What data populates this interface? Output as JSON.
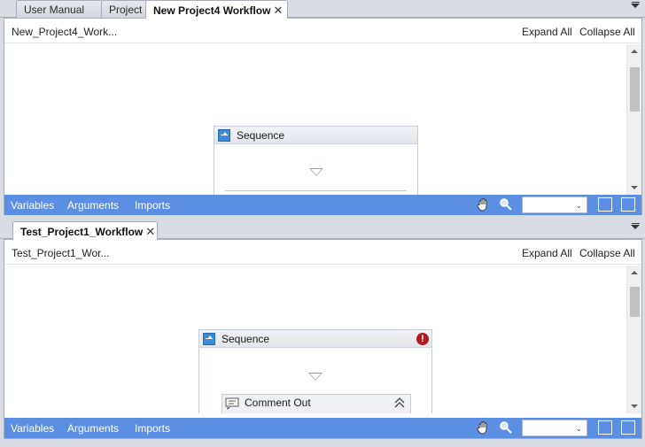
{
  "top_pane": {
    "tabs": [
      {
        "label": "User Manual"
      },
      {
        "label": "Project"
      },
      {
        "label": "New Project4 Workflow",
        "active": true
      }
    ],
    "breadcrumb": "New_Project4_Work...",
    "expand_all": "Expand All",
    "collapse_all": "Collapse All",
    "sequence_title": "Sequence",
    "footer": {
      "variables": "Variables",
      "arguments": "Arguments",
      "imports": "Imports",
      "zoom_value": ""
    }
  },
  "bottom_pane": {
    "tabs": [
      {
        "label": "Test_Project1_Workflow",
        "active": true
      }
    ],
    "breadcrumb": "Test_Project1_Wor...",
    "expand_all": "Expand All",
    "collapse_all": "Collapse All",
    "sequence_title": "Sequence",
    "sequence_error": "!",
    "comment_out_title": "Comment Out",
    "footer": {
      "variables": "Variables",
      "arguments": "Arguments",
      "imports": "Imports",
      "zoom_value": ""
    }
  },
  "tab_close_glyph": "✕",
  "icons": {
    "hand": "hand-icon",
    "zoom": "magnifier-icon",
    "fit": "fit-to-screen-icon",
    "overview": "overview-icon",
    "sequence": "sequence-icon",
    "error": "error-icon",
    "comment": "comment-icon",
    "collapse": "chevron-double-up-icon"
  },
  "colors": {
    "footer_bar": "#5b8fe3",
    "error": "#b01c1c",
    "sequence_icon": "#3a8ad8"
  }
}
